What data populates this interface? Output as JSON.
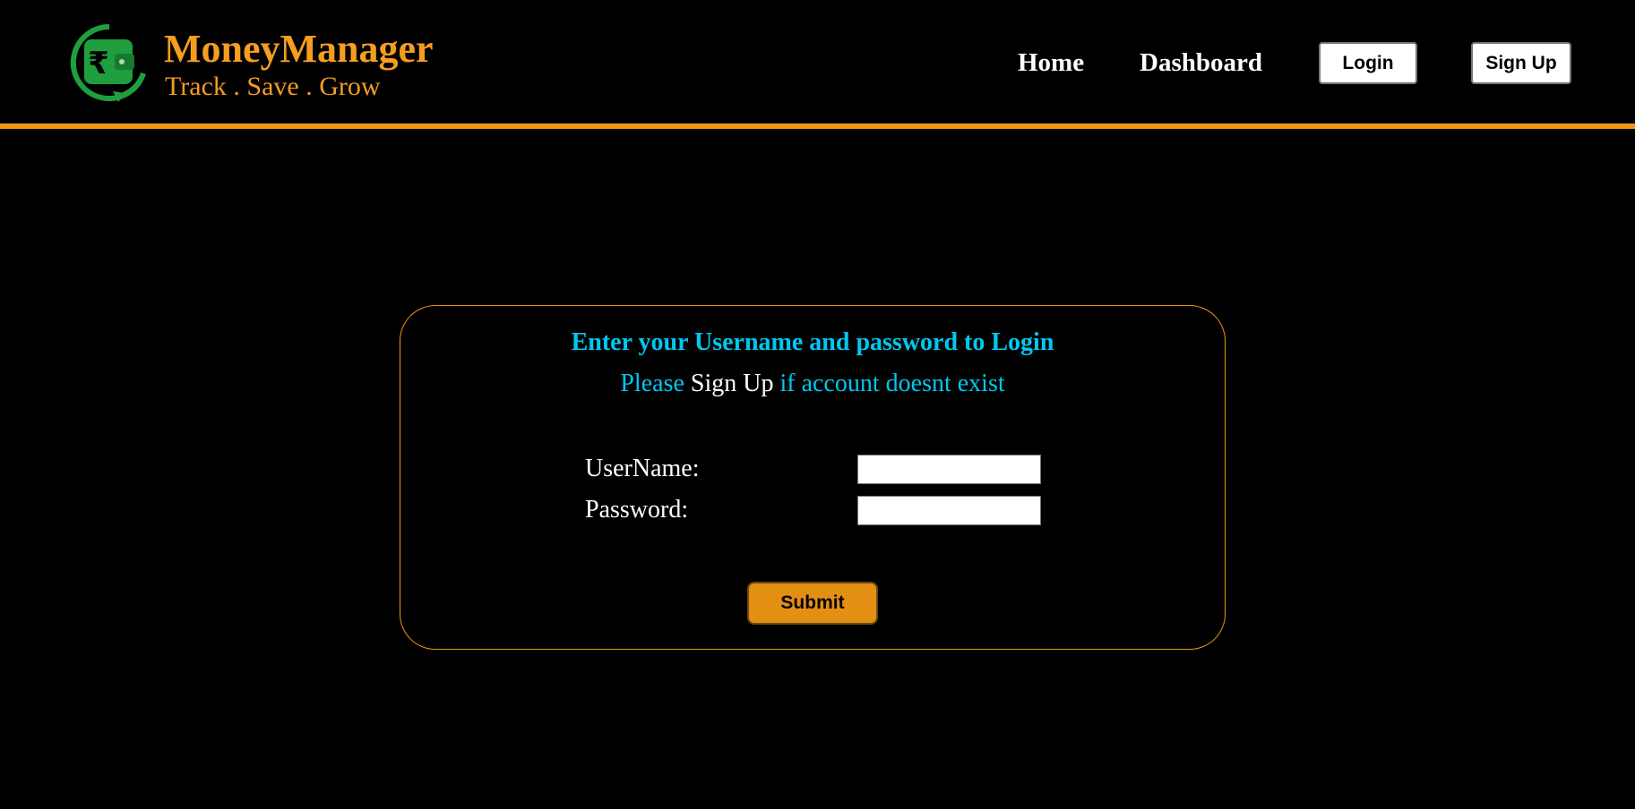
{
  "header": {
    "brand_name": "MoneyManager",
    "tagline": "Track . Save . Grow",
    "logo_icon": "rupee-wallet-icon",
    "nav": {
      "home": "Home",
      "dashboard": "Dashboard",
      "login": "Login",
      "signup": "Sign Up"
    }
  },
  "login_form": {
    "title": "Enter your Username and password to Login",
    "subtitle_prefix": "Please",
    "subtitle_link": "Sign Up",
    "subtitle_suffix": "if account doesnt exist",
    "username_label": "UserName:",
    "username_value": "",
    "password_label": "Password:",
    "password_value": "",
    "submit_label": "Submit"
  },
  "colors": {
    "background": "#000000",
    "accent_orange": "#f49d1f",
    "divider_orange": "#f0960f",
    "title_cyan": "#00c8ef",
    "submit_orange": "#e38f13",
    "logo_green": "#1f9e3e"
  }
}
